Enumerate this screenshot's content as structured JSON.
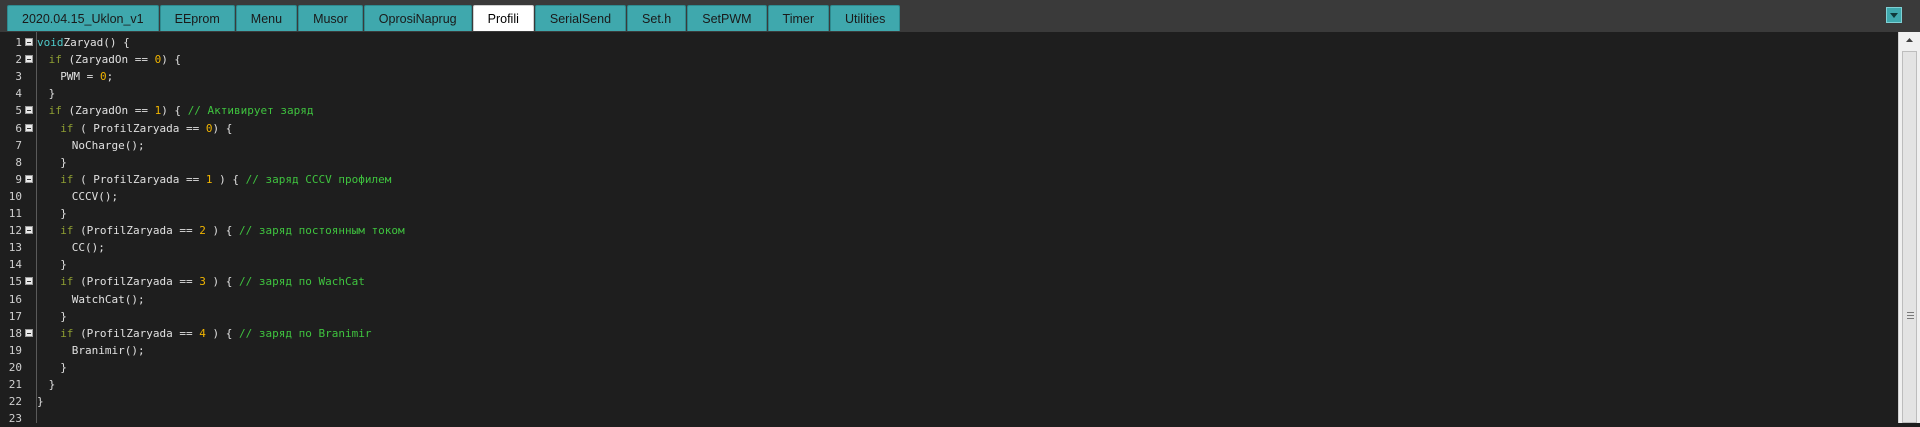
{
  "tabs": [
    {
      "label": "2020.04.15_Uklon_v1",
      "active": false
    },
    {
      "label": "EEprom",
      "active": false
    },
    {
      "label": "Menu",
      "active": false
    },
    {
      "label": "Musor",
      "active": false
    },
    {
      "label": "OprosiNaprug",
      "active": false
    },
    {
      "label": "Profili",
      "active": true
    },
    {
      "label": "SerialSend",
      "active": false
    },
    {
      "label": "Set.h",
      "active": false
    },
    {
      "label": "SetPWM",
      "active": false
    },
    {
      "label": "Timer",
      "active": false
    },
    {
      "label": "Utilities",
      "active": false
    }
  ],
  "colors": {
    "tab": "#3fa8ad",
    "tab_active": "#ffffff",
    "editor_bg": "#1e1e1e",
    "keyword_void": "#4ec9c9",
    "keyword": "#8e9e32",
    "number": "#f0b400",
    "comment": "#3fc33f"
  },
  "icons": {
    "tab_menu": "chevron-down-icon",
    "fold": "collapse-minus-icon",
    "scroll_up": "arrow-up-icon"
  },
  "code_lines": [
    {
      "n": "1",
      "fold": true,
      "indent": 0,
      "parts": [
        [
          "kw-void",
          "void"
        ],
        [
          "",
          "Zaryad() {"
        ]
      ]
    },
    {
      "n": "2",
      "fold": true,
      "indent": 1,
      "parts": [
        [
          "kw",
          "if"
        ],
        [
          "",
          "(ZaryadOn == "
        ],
        [
          "num",
          "0"
        ],
        [
          "",
          ") {"
        ]
      ]
    },
    {
      "n": "3",
      "fold": false,
      "indent": 2,
      "parts": [
        [
          "",
          "PWM = "
        ],
        [
          "num",
          "0"
        ],
        [
          "",
          ";"
        ]
      ]
    },
    {
      "n": "4",
      "fold": false,
      "indent": 1,
      "parts": [
        [
          "",
          "}"
        ]
      ]
    },
    {
      "n": "5",
      "fold": true,
      "indent": 1,
      "parts": [
        [
          "kw",
          "if"
        ],
        [
          "",
          "(ZaryadOn == "
        ],
        [
          "num",
          "1"
        ],
        [
          "",
          ") { "
        ],
        [
          "cmt",
          "// Активирует заряд"
        ]
      ]
    },
    {
      "n": "6",
      "fold": true,
      "indent": 2,
      "parts": [
        [
          "kw",
          "if"
        ],
        [
          "",
          "( ProfilZaryada == "
        ],
        [
          "num",
          "0"
        ],
        [
          "",
          ") {"
        ]
      ]
    },
    {
      "n": "7",
      "fold": false,
      "indent": 3,
      "parts": [
        [
          "",
          "NoCharge();"
        ]
      ]
    },
    {
      "n": "8",
      "fold": false,
      "indent": 2,
      "parts": [
        [
          "",
          "}"
        ]
      ]
    },
    {
      "n": "9",
      "fold": true,
      "indent": 2,
      "parts": [
        [
          "kw",
          "if"
        ],
        [
          "",
          "( ProfilZaryada == "
        ],
        [
          "num",
          "1"
        ],
        [
          "",
          " ) { "
        ],
        [
          "cmt",
          "// заряд CCCV профилем"
        ]
      ]
    },
    {
      "n": "10",
      "fold": false,
      "indent": 3,
      "parts": [
        [
          "",
          "CCCV();"
        ]
      ]
    },
    {
      "n": "11",
      "fold": false,
      "indent": 2,
      "parts": [
        [
          "",
          "}"
        ]
      ]
    },
    {
      "n": "12",
      "fold": true,
      "indent": 2,
      "parts": [
        [
          "kw",
          "if"
        ],
        [
          "",
          "(ProfilZaryada == "
        ],
        [
          "num",
          "2"
        ],
        [
          "",
          " ) { "
        ],
        [
          "cmt",
          "// заряд постоянным током"
        ]
      ]
    },
    {
      "n": "13",
      "fold": false,
      "indent": 3,
      "parts": [
        [
          "",
          "CC();"
        ]
      ]
    },
    {
      "n": "14",
      "fold": false,
      "indent": 2,
      "parts": [
        [
          "",
          "}"
        ]
      ]
    },
    {
      "n": "15",
      "fold": true,
      "indent": 2,
      "parts": [
        [
          "kw",
          "if"
        ],
        [
          "",
          "(ProfilZaryada == "
        ],
        [
          "num",
          "3"
        ],
        [
          "",
          " ) { "
        ],
        [
          "cmt",
          "// заряд по WachCat"
        ]
      ]
    },
    {
      "n": "16",
      "fold": false,
      "indent": 3,
      "parts": [
        [
          "",
          "WatchCat();"
        ]
      ]
    },
    {
      "n": "17",
      "fold": false,
      "indent": 2,
      "parts": [
        [
          "",
          "}"
        ]
      ]
    },
    {
      "n": "18",
      "fold": true,
      "indent": 2,
      "parts": [
        [
          "kw",
          "if"
        ],
        [
          "",
          "(ProfilZaryada == "
        ],
        [
          "num",
          "4"
        ],
        [
          "",
          " ) { "
        ],
        [
          "cmt",
          "// заряд по Branimir"
        ]
      ]
    },
    {
      "n": "19",
      "fold": false,
      "indent": 3,
      "parts": [
        [
          "",
          "Branimir();"
        ]
      ]
    },
    {
      "n": "20",
      "fold": false,
      "indent": 2,
      "parts": [
        [
          "",
          "}"
        ]
      ]
    },
    {
      "n": "21",
      "fold": false,
      "indent": 1,
      "parts": [
        [
          "",
          "}"
        ]
      ]
    },
    {
      "n": "22",
      "fold": false,
      "indent": 0,
      "parts": [
        [
          "",
          "}"
        ]
      ]
    },
    {
      "n": "23",
      "fold": false,
      "indent": 0,
      "parts": []
    }
  ]
}
